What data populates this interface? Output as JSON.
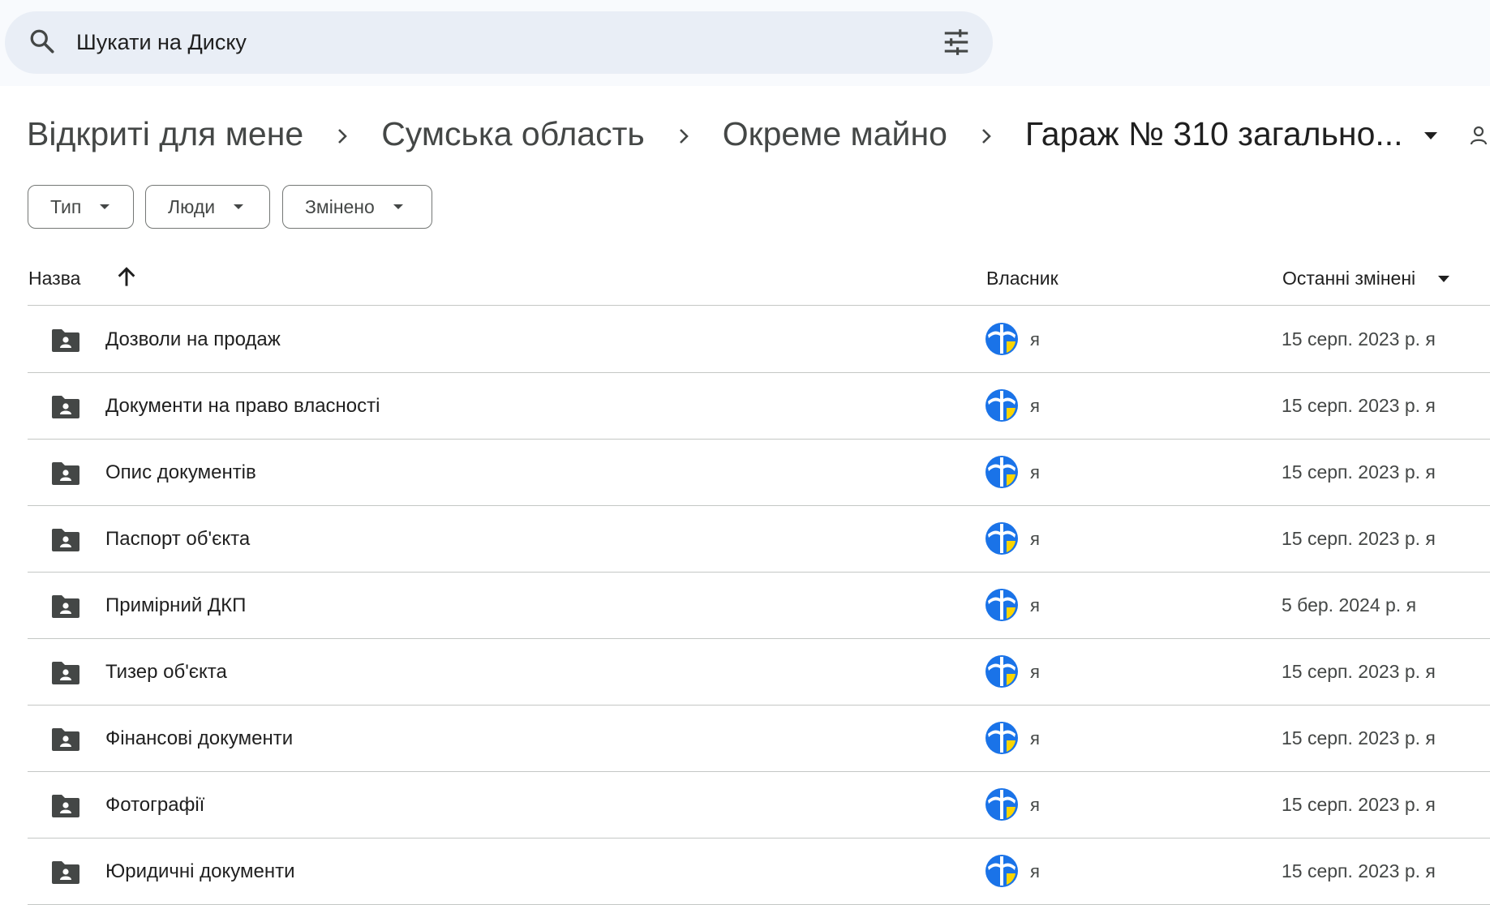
{
  "search": {
    "placeholder": "Шукати на Диску"
  },
  "breadcrumb": {
    "items": [
      "Відкриті для мене",
      "Сумська область",
      "Окреме майно",
      "Гараж № 310 загально..."
    ]
  },
  "filters": {
    "type": "Тип",
    "people": "Люди",
    "modified": "Змінено"
  },
  "columns": {
    "name": "Назва",
    "owner": "Власник",
    "modified": "Останні змінені"
  },
  "rows": [
    {
      "name": "Дозволи на продаж",
      "owner": "я",
      "modified": "15 серп. 2023 р. я"
    },
    {
      "name": "Документи на право власності",
      "owner": "я",
      "modified": "15 серп. 2023 р. я"
    },
    {
      "name": "Опис документів",
      "owner": "я",
      "modified": "15 серп. 2023 р. я"
    },
    {
      "name": "Паспорт об'єкта",
      "owner": "я",
      "modified": "15 серп. 2023 р. я"
    },
    {
      "name": "Примірний ДКП",
      "owner": "я",
      "modified": "5 бер. 2024 р. я"
    },
    {
      "name": "Тизер об'єкта",
      "owner": "я",
      "modified": "15 серп. 2023 р. я"
    },
    {
      "name": "Фінансові документи",
      "owner": "я",
      "modified": "15 серп. 2023 р. я"
    },
    {
      "name": "Фотографії",
      "owner": "я",
      "modified": "15 серп. 2023 р. я"
    },
    {
      "name": "Юридичні документи",
      "owner": "я",
      "modified": "15 серп. 2023 р. я"
    }
  ],
  "icons": {
    "search": "search-icon",
    "filter": "tune-icon",
    "folder": "shared-folder-icon",
    "avatar": "owner-avatar",
    "sort": "arrow-up-icon"
  },
  "colors": {
    "topbar_bg": "#f8fafd",
    "search_bg": "#e9eef6",
    "avatar_blue": "#1a73e8",
    "avatar_yellow": "#fbd500",
    "divider": "#c4c7c5"
  }
}
